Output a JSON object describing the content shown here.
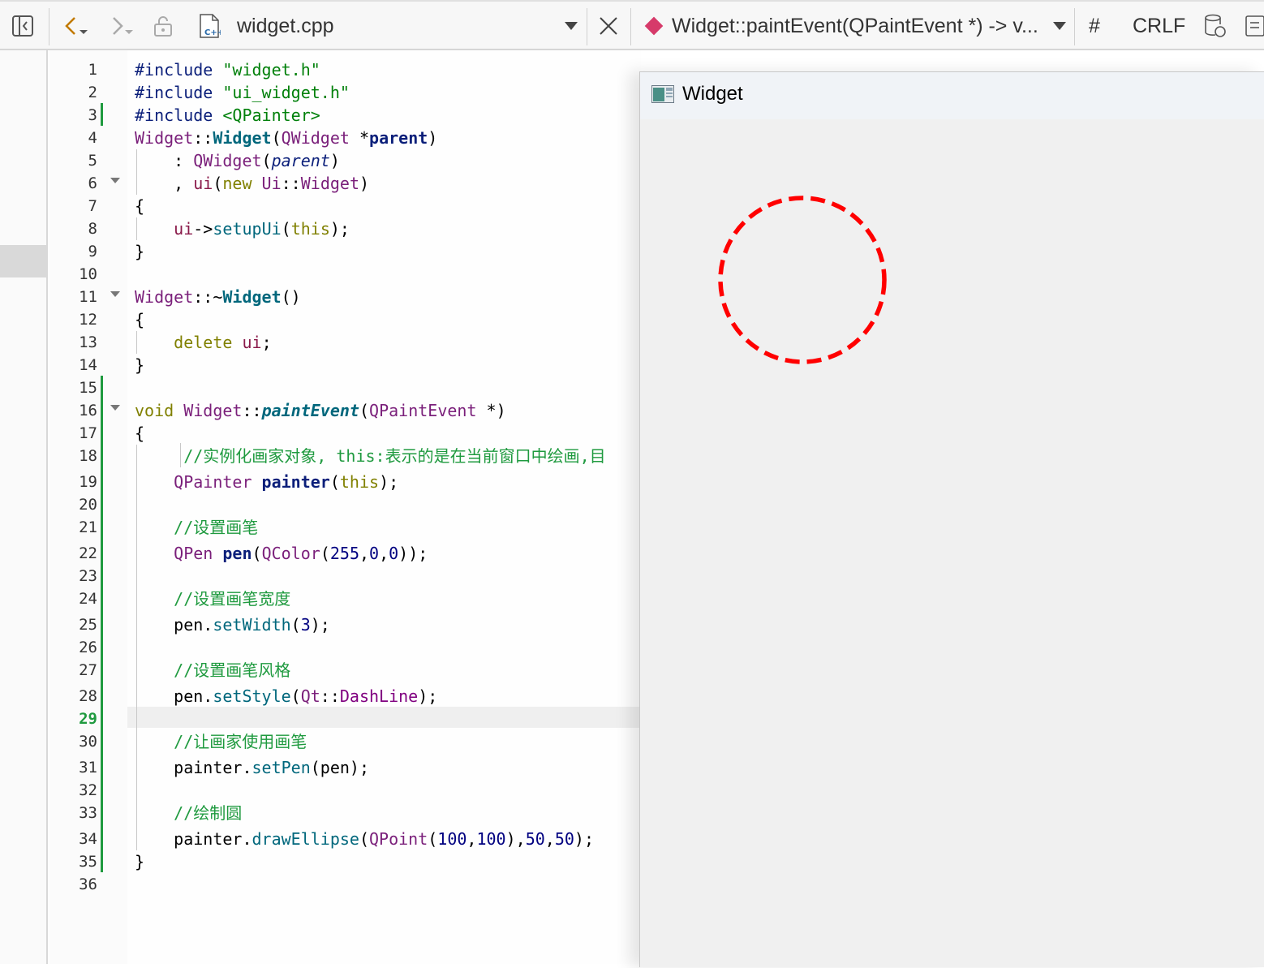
{
  "toolbar": {
    "file_name": "widget.cpp",
    "symbol": "Widget::paintEvent(QPaintEvent *) -> v...",
    "hash_label": "#",
    "line_ending": "CRLF",
    "icons": [
      "toggle-sidebar-icon",
      "back-icon",
      "forward-icon",
      "lock-icon",
      "cpp-file-icon",
      "file-dropdown-icon",
      "close-icon",
      "symbol-icon",
      "symbol-dropdown-icon",
      "encoding-icon",
      "outline-icon"
    ]
  },
  "editor": {
    "current_line": 29,
    "line_numbers": [
      "1",
      "2",
      "3",
      "4",
      "5",
      "6",
      "7",
      "8",
      "9",
      "10",
      "11",
      "12",
      "13",
      "14",
      "15",
      "16",
      "17",
      "18",
      "19",
      "20",
      "21",
      "22",
      "23",
      "24",
      "25",
      "26",
      "27",
      "28",
      "29",
      "30",
      "31",
      "32",
      "33",
      "34",
      "35",
      "36"
    ],
    "tokens": {
      "l1a": "#include",
      "l1b": "\"widget.h\"",
      "l2a": "#include",
      "l2b": "\"ui_widget.h\"",
      "l3a": "#include",
      "l3b": "<QPainter>",
      "l4a": "Widget",
      "l4b": "::",
      "l4c": "Widget",
      "l4d": "(",
      "l4e": "QWidget",
      "l4f": " *",
      "l4g": "parent",
      "l4h": ")",
      "l5a": "    : ",
      "l5b": "QWidget",
      "l5c": "(",
      "l5d": "parent",
      "l5e": ")",
      "l6a": "    , ",
      "l6b": "ui",
      "l6c": "(",
      "l6d": "new",
      "l6e": " Ui",
      "l6f": "::",
      "l6g": "Widget",
      "l6h": ")",
      "l7": "{",
      "l8a": "    ",
      "l8b": "ui",
      "l8c": "->",
      "l8d": "setupUi",
      "l8e": "(",
      "l8f": "this",
      "l8g": ");",
      "l9": "}",
      "l11a": "Widget",
      "l11b": "::~",
      "l11c": "Widget",
      "l11d": "()",
      "l12": "{",
      "l13a": "    ",
      "l13b": "delete",
      "l13c": " ",
      "l13d": "ui",
      "l13e": ";",
      "l14": "}",
      "l16a": "void",
      "l16b": " Widget",
      "l16c": "::",
      "l16d": "paintEvent",
      "l16e": "(",
      "l16f": "QPaintEvent",
      "l16g": " *)",
      "l17": "{",
      "l18": "     //实例化画家对象, this:表示的是在当前窗口中绘画,目",
      "l19a": "    ",
      "l19b": "QPainter",
      "l19c": " ",
      "l19d": "painter",
      "l19e": "(",
      "l19f": "this",
      "l19g": ");",
      "l21": "    //设置画笔",
      "l22a": "    ",
      "l22b": "QPen",
      "l22c": " ",
      "l22d": "pen",
      "l22e": "(",
      "l22f": "QColor",
      "l22g": "(",
      "l22h": "255",
      "l22i": ",",
      "l22j": "0",
      "l22k": ",",
      "l22l": "0",
      "l22m": "));",
      "l24": "    //设置画笔宽度",
      "l25a": "    pen.",
      "l25b": "setWidth",
      "l25c": "(",
      "l25d": "3",
      "l25e": ");",
      "l27": "    //设置画笔风格",
      "l28a": "    pen.",
      "l28b": "setStyle",
      "l28c": "(",
      "l28d": "Qt",
      "l28e": "::",
      "l28f": "DashLine",
      "l28g": ");",
      "l30": "    //让画家使用画笔",
      "l31a": "    painter.",
      "l31b": "setPen",
      "l31c": "(pen);",
      "l33": "    //绘制圆",
      "l34a": "    painter.",
      "l34b": "drawEllipse",
      "l34c": "(",
      "l34d": "QPoint",
      "l34e": "(",
      "l34f": "100",
      "l34g": ",",
      "l34h": "100",
      "l34i": "),",
      "l34j": "50",
      "l34k": ",",
      "l34l": "50",
      "l34m": ");",
      "l35": "}"
    }
  },
  "widget_window": {
    "title": "Widget",
    "circle_color": "#ff0000"
  }
}
